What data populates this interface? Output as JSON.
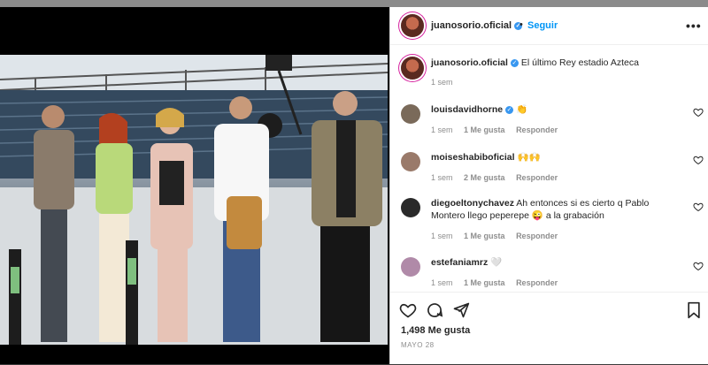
{
  "post": {
    "username": "juanosorio.oficial",
    "separator": "•",
    "follow_label": "Seguir",
    "more_label": "•••",
    "caption": "El último Rey estadio Azteca",
    "caption_time": "1 sem",
    "likes": "1,498 Me gusta",
    "date": "MAYO 28"
  },
  "comments": [
    {
      "user": "louisdavidhorne",
      "verified": true,
      "text": "👏",
      "time": "1 sem",
      "likes": "",
      "reply": "Responder",
      "avatar_color": "#7a6a5a"
    },
    {
      "user": "moiseshabiboficial",
      "verified": false,
      "text": "🙌🙌",
      "time": "1 sem",
      "likes": "2 Me gusta",
      "reply": "Responder",
      "avatar_color": "#9a7a6a"
    },
    {
      "user": "diegoeltonychavez",
      "verified": false,
      "text": "Ah entonces si es cierto q Pablo Montero llego peperepe 😜 a la grabación",
      "time": "1 sem",
      "likes": "1 Me gusta",
      "reply": "Responder",
      "avatar_color": "#2a2a2a"
    },
    {
      "user": "estefaniamrz",
      "verified": false,
      "text": "🤍",
      "time": "1 sem",
      "likes": "1 Me gusta",
      "reply": "Responder",
      "avatar_color": "#b08aa8"
    }
  ]
}
